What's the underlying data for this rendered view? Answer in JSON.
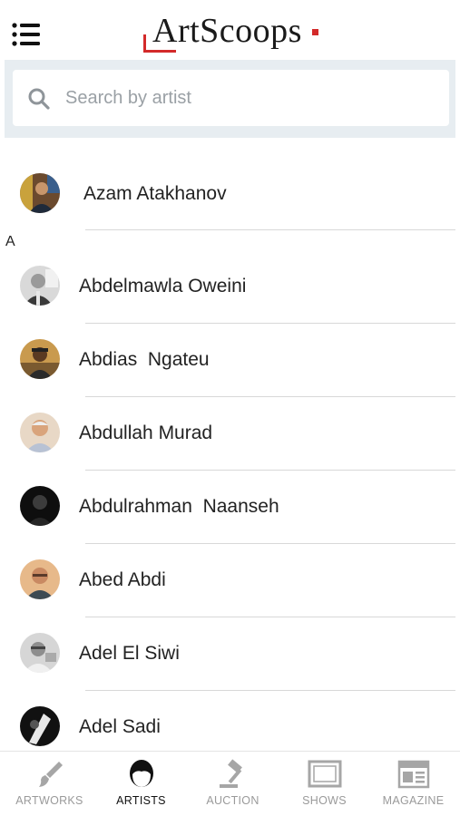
{
  "header": {
    "logo_text": "ArtScoops",
    "brand_color": "#d32a2a",
    "menu_icon": "hamburger-menu-icon"
  },
  "search": {
    "value": "",
    "placeholder": "Search by artist",
    "icon": "search-icon"
  },
  "list": {
    "featured": {
      "name": "Azam Atakhanov"
    },
    "section_letter": "A",
    "artists": [
      {
        "name": "Abdelmawla Oweini"
      },
      {
        "name": "Abdias  Ngateu"
      },
      {
        "name": "Abdullah Murad"
      },
      {
        "name": "Abdulrahman  Naanseh"
      },
      {
        "name": "Abed Abdi"
      },
      {
        "name": "Adel El Siwi"
      },
      {
        "name": "Adel Sadi"
      }
    ]
  },
  "nav": {
    "active": "artists",
    "items": [
      {
        "id": "artworks",
        "label": "ARTWORKS",
        "icon": "paintbrush-icon"
      },
      {
        "id": "artists",
        "label": "ARTISTS",
        "icon": "artist-head-icon"
      },
      {
        "id": "auction",
        "label": "AUCTION",
        "icon": "gavel-icon"
      },
      {
        "id": "shows",
        "label": "SHOWS",
        "icon": "frame-icon"
      },
      {
        "id": "magazine",
        "label": "MAGAZINE",
        "icon": "newspaper-icon"
      }
    ]
  }
}
